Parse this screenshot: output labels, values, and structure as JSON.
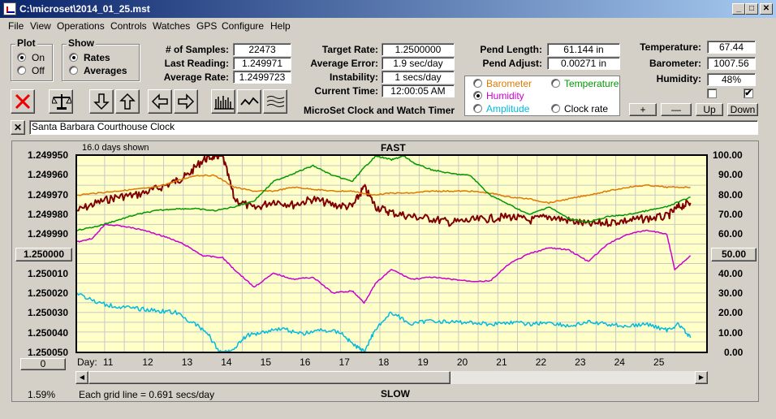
{
  "window": {
    "title": "C:\\microset\\2014_01_25.mst"
  },
  "menu": [
    "File",
    "View",
    "Operations",
    "Controls",
    "Watches",
    "GPS",
    "Configure",
    "Help"
  ],
  "plot_group": {
    "label": "Plot",
    "on": "On",
    "off": "Off",
    "selected": "on"
  },
  "show_group": {
    "label": "Show",
    "rates": "Rates",
    "averages": "Averages",
    "selected": "rates"
  },
  "stats": {
    "samples_label": "# of Samples:",
    "samples": "22473",
    "last_reading_label": "Last Reading:",
    "last_reading": "1.249971",
    "average_rate_label": "Average Rate:",
    "average_rate": "1.2499723",
    "target_rate_label": "Target Rate:",
    "target_rate": "1.2500000",
    "average_error_label": "Average Error:",
    "average_error": "1.9 sec/day",
    "instability_label": "Instability:",
    "instability": "1 secs/day",
    "current_time_label": "Current Time:",
    "current_time": "12:00:05 AM",
    "app_name": "MicroSet Clock and Watch Timer",
    "pend_length_label": "Pend Length:",
    "pend_length": "61.144 in",
    "pend_adjust_label": "Pend Adjust:",
    "pend_adjust": "0.00271 in",
    "temperature_label": "Temperature:",
    "temperature": "67.44",
    "barometer_label": "Barometer:",
    "barometer": "1007.56",
    "humidity_label": "Humidity:",
    "humidity": "48%"
  },
  "sensor_options": {
    "barometer": "Barometer",
    "temperature": "Temperature",
    "humidity": "Humidity",
    "amplitude": "Amplitude",
    "clock_rate": "Clock rate",
    "selected": "humidity",
    "colors": {
      "barometer": "#e07800",
      "temperature": "#009900",
      "humidity": "#cc00cc",
      "amplitude": "#00bbdd",
      "clock_rate": "#000000"
    }
  },
  "scale_buttons": {
    "plus": "+",
    "minus": "—",
    "up": "Up",
    "down": "Down"
  },
  "checkboxes": {
    "left_checked": false,
    "right_checked": true,
    "check_glyph": "✔"
  },
  "watch_name": {
    "close": "✕",
    "value": "Santa Barbara Courthouse Clock"
  },
  "chart_header": {
    "days_shown": "16.0 days shown",
    "fast": "FAST",
    "slow": "SLOW"
  },
  "chart_footer": {
    "percent": "1.59%",
    "grid_note": "Each grid line = 0.691 secs/day",
    "left_button": "0"
  },
  "chart_data": {
    "type": "line",
    "xlabel": "Day:",
    "x_ticks": [
      "11",
      "12",
      "13",
      "14",
      "15",
      "16",
      "17",
      "18",
      "19",
      "20",
      "21",
      "22",
      "23",
      "24",
      "25"
    ],
    "xlim": [
      10.3,
      26.3
    ],
    "left_axis": {
      "ticks": [
        "1.249950",
        "1.249960",
        "1.249970",
        "1.249980",
        "1.249990",
        "1.250000",
        "1.250010",
        "1.250020",
        "1.250030",
        "1.250040",
        "1.250050"
      ],
      "center_button": "1.250000",
      "ylim_top": 1.24995,
      "ylim_bottom": 1.25005,
      "inverted": true
    },
    "right_axis": {
      "ticks": [
        "100.00",
        "90.00",
        "80.00",
        "70.00",
        "60.00",
        "50.00",
        "40.00",
        "30.00",
        "20.00",
        "10.00",
        "0.00"
      ],
      "center_button": "50.00",
      "ylim": [
        0,
        100
      ]
    },
    "series": [
      {
        "name": "Clock rate",
        "color": "#800000",
        "axis": "left",
        "x": [
          10.3,
          10.8,
          11.3,
          11.8,
          12.3,
          12.8,
          13.1,
          13.5,
          13.8,
          14.0,
          14.3,
          14.8,
          15.3,
          15.8,
          16.3,
          16.8,
          17.3,
          17.6,
          17.9,
          18.3,
          18.8,
          19.3,
          19.8,
          20.3,
          20.8,
          21.3,
          21.8,
          22.3,
          22.8,
          23.3,
          23.8,
          24.3,
          24.8,
          25.3,
          25.6,
          25.9
        ],
        "y": [
          1.249978,
          1.249974,
          1.249971,
          1.24997,
          1.249967,
          1.249963,
          1.24996,
          1.249952,
          1.24995,
          1.24995,
          1.249972,
          1.249977,
          1.249973,
          1.249975,
          1.249972,
          1.249975,
          1.249976,
          1.249966,
          1.249976,
          1.249979,
          1.249981,
          1.249982,
          1.249984,
          1.249983,
          1.249982,
          1.249981,
          1.249983,
          1.249981,
          1.249983,
          1.249985,
          1.249984,
          1.249983,
          1.249982,
          1.249981,
          1.249976,
          1.249974
        ]
      },
      {
        "name": "Barometer",
        "color": "#e07800",
        "axis": "right",
        "x": [
          10.3,
          10.8,
          11.3,
          11.8,
          12.3,
          12.8,
          13.3,
          13.8,
          14.3,
          14.8,
          15.3,
          15.8,
          16.3,
          16.8,
          17.3,
          17.8,
          18.3,
          18.8,
          19.3,
          19.8,
          20.3,
          20.8,
          21.3,
          21.8,
          22.3,
          22.8,
          23.3,
          23.8,
          24.3,
          24.8,
          25.3,
          25.9
        ],
        "y": [
          80,
          81,
          82,
          83,
          84,
          87,
          90,
          90,
          84,
          82,
          82,
          84,
          83,
          82,
          82,
          80,
          81,
          81,
          82,
          82,
          82,
          81,
          79,
          78,
          76,
          78,
          80,
          82,
          84,
          85,
          84,
          84
        ]
      },
      {
        "name": "Temperature",
        "color": "#009900",
        "axis": "right",
        "x": [
          10.3,
          10.8,
          11.3,
          11.8,
          12.3,
          12.8,
          13.3,
          13.8,
          14.3,
          14.8,
          15.3,
          15.8,
          16.3,
          16.8,
          17.3,
          17.6,
          17.9,
          18.3,
          18.6,
          18.9,
          19.3,
          19.8,
          20.3,
          20.8,
          21.3,
          21.8,
          22.3,
          22.8,
          23.3,
          23.8,
          24.3,
          24.8,
          25.3,
          25.9
        ],
        "y": [
          62,
          64,
          67,
          70,
          72,
          73,
          73,
          72,
          74,
          77,
          87,
          91,
          95,
          90,
          87,
          94,
          100,
          98,
          100,
          96,
          93,
          91,
          90,
          80,
          75,
          70,
          74,
          68,
          66,
          69,
          70,
          72,
          74,
          79
        ]
      },
      {
        "name": "Humidity",
        "color": "#cc00cc",
        "axis": "right",
        "x": [
          10.3,
          10.7,
          11.0,
          11.5,
          12.0,
          12.5,
          13.0,
          13.5,
          14.0,
          14.3,
          14.8,
          15.3,
          15.8,
          16.3,
          16.8,
          17.3,
          17.6,
          17.9,
          18.3,
          18.8,
          19.3,
          19.8,
          20.3,
          20.8,
          21.3,
          21.8,
          22.3,
          22.8,
          23.3,
          23.8,
          24.3,
          24.8,
          25.3,
          25.5,
          25.9
        ],
        "y": [
          56,
          58,
          65,
          64,
          62,
          59,
          55,
          49,
          48,
          42,
          33,
          40,
          37,
          38,
          30,
          31,
          25,
          35,
          42,
          37,
          38,
          37,
          36,
          36,
          45,
          50,
          53,
          52,
          46,
          55,
          60,
          62,
          60,
          42,
          49
        ]
      },
      {
        "name": "Amplitude",
        "color": "#00bbdd",
        "axis": "right",
        "x": [
          10.3,
          10.8,
          11.3,
          11.8,
          12.3,
          12.8,
          13.3,
          13.6,
          13.9,
          14.2,
          14.6,
          15.0,
          15.5,
          16.0,
          16.5,
          17.0,
          17.3,
          17.6,
          17.9,
          18.3,
          18.8,
          19.3,
          19.8,
          20.3,
          20.8,
          21.3,
          21.8,
          22.3,
          22.8,
          23.3,
          23.8,
          24.3,
          24.8,
          25.3,
          25.6,
          25.9
        ],
        "y": [
          30,
          25,
          23,
          22,
          21,
          20,
          14,
          10,
          0,
          0,
          8,
          10,
          12,
          9,
          11,
          10,
          4,
          0,
          12,
          20,
          14,
          16,
          15,
          15,
          14,
          15,
          14,
          15,
          13,
          15,
          14,
          13,
          14,
          11,
          14,
          7
        ]
      }
    ]
  }
}
